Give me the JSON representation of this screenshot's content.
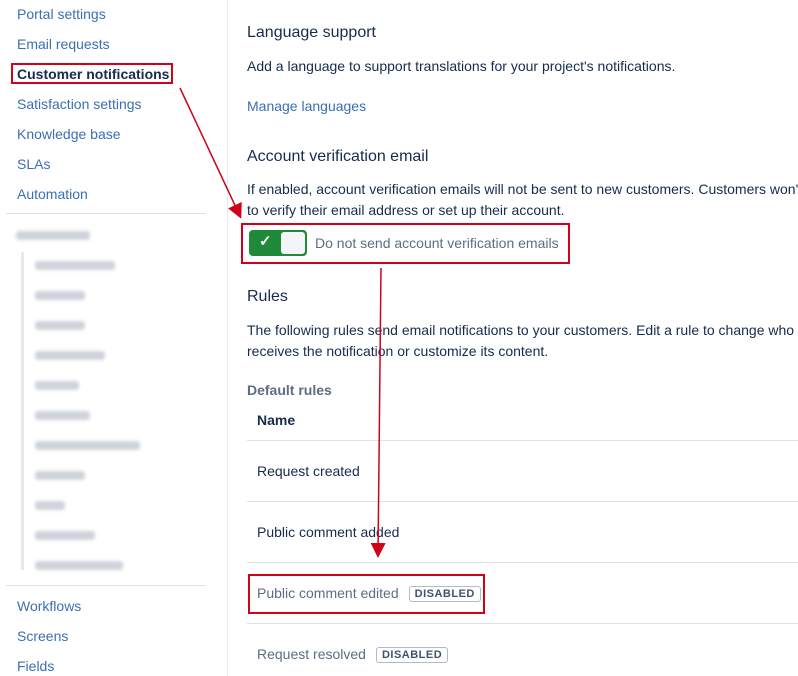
{
  "sidebar": {
    "items_top": [
      "Portal settings",
      "Email requests",
      "Customer notifications",
      "Satisfaction settings",
      "Knowledge base",
      "SLAs",
      "Automation"
    ],
    "active_item": "Customer notifications",
    "items_bottom": [
      "Workflows",
      "Screens",
      "Fields"
    ]
  },
  "language": {
    "title": "Language support",
    "description": "Add a language to support translations for your project's notifications.",
    "manage_link": "Manage languages"
  },
  "verification": {
    "title": "Account verification email",
    "description_line1": "If enabled, account verification emails will not be sent to new customers. Customers won't",
    "description_line2": "to verify their email address or set up their account.",
    "toggle_label": "Do not send account verification emails",
    "toggle_on": true
  },
  "rules": {
    "title": "Rules",
    "description_line1": "The following rules send email notifications to your customers. Edit a rule to change who",
    "description_line2": "receives the notification or customize its content.",
    "default_rules_label": "Default rules",
    "column_name": "Name",
    "rows": [
      {
        "name": "Request created",
        "status": ""
      },
      {
        "name": "Public comment added",
        "status": ""
      },
      {
        "name": "Public comment edited",
        "status": "DISABLED"
      },
      {
        "name": "Request resolved",
        "status": "DISABLED"
      }
    ]
  },
  "colors": {
    "link": "#3b6fb3",
    "annotation_red": "#d0021b",
    "toggle_green": "#1f8a3a"
  }
}
